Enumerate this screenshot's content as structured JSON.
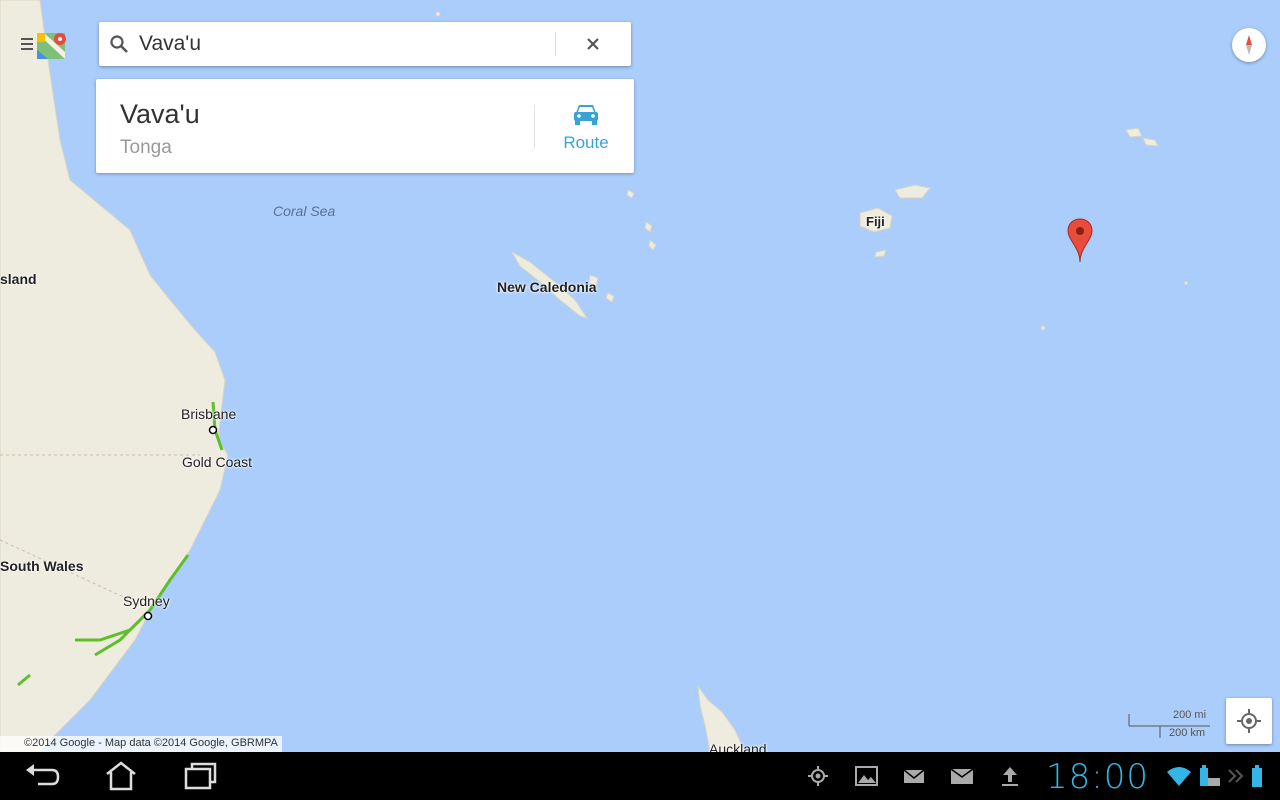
{
  "search": {
    "value": "Vava'u"
  },
  "result": {
    "place_name": "Vava'u",
    "country": "Tonga",
    "route_label": "Route"
  },
  "map": {
    "labels": {
      "coral_sea": "Coral Sea",
      "queensland": "sland",
      "new_caledonia": "New Caledonia",
      "fiji": "Fiji",
      "brisbane": "Brisbane",
      "gold_coast": "Gold Coast",
      "new_south_wales": "South Wales",
      "sydney": "Sydney",
      "auckland": "Auckland"
    },
    "scale": {
      "miles": "200 mi",
      "km": "200 km"
    },
    "copyright": "©2014 Google - Map data ©2014 Google, GBRMPA"
  },
  "statusbar": {
    "time": "18:00"
  },
  "colors": {
    "water": "#abcdfb",
    "land": "#eeebdf",
    "accent": "#33b5e5",
    "marker": "#e74c3c",
    "route": "#3aa3d6"
  },
  "icons": [
    "menu-icon",
    "maps-logo-icon",
    "search-icon",
    "close-icon",
    "car-icon",
    "compass-icon",
    "map-marker-icon",
    "my-location-icon",
    "back-icon",
    "home-icon",
    "recent-apps-icon",
    "gps-icon",
    "gallery-icon",
    "email-icon",
    "mail-icon",
    "upload-icon",
    "wifi-icon",
    "battery-icon",
    "keyboard-icon"
  ]
}
